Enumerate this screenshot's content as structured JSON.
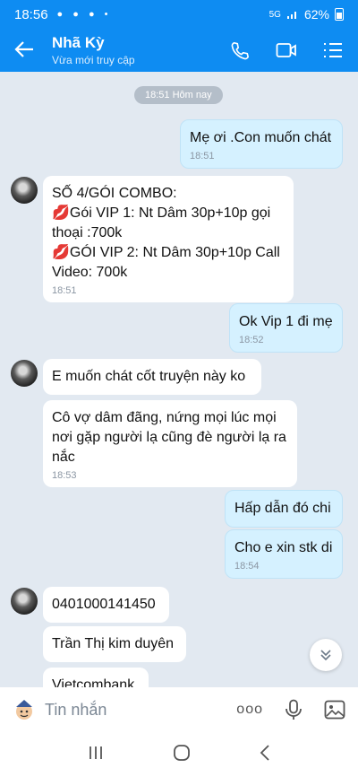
{
  "status": {
    "time": "18:56",
    "notif": "● ● ● •",
    "network": "5G",
    "battery": "62%"
  },
  "header": {
    "name": "Nhã Kỳ",
    "subtitle": "Vừa mới truy cập"
  },
  "chat": {
    "date_pill": "18:51 Hôm nay",
    "messages": [
      {
        "from": "me",
        "text": "Mẹ ơi .Con muốn chát",
        "time": "18:51"
      },
      {
        "from": "them",
        "lines": [
          "SỐ 4/GÓI COMBO:",
          "💋Gói VIP 1: Nt Dâm 30p+10p gọi",
          "thoại :700k",
          "💋GÓI VIP 2: Nt Dâm 30p+10p Call",
          "Video: 700k"
        ],
        "time": "18:51"
      },
      {
        "from": "me",
        "text": "Ok Vip 1 đi mẹ",
        "time": "18:52"
      },
      {
        "from": "them",
        "text": "E muốn chát cốt truyện này ko"
      },
      {
        "from": "them",
        "lines": [
          "Cô vợ dâm đãng, nứng mọi lúc mọi",
          "nơi gặp người lạ cũng đè người lạ ra",
          "nắc"
        ],
        "time": "18:53"
      },
      {
        "from": "me",
        "text": "Hấp dẫn đó chi"
      },
      {
        "from": "me",
        "text": "Cho e xin stk di",
        "time": "18:54"
      },
      {
        "from": "them",
        "text": "0401000141450"
      },
      {
        "from": "them",
        "text": "Trần Thị kim duyên"
      },
      {
        "from": "them",
        "text": "Vietcombank"
      }
    ]
  },
  "input": {
    "placeholder": "Tin nhắn",
    "more": "ooo"
  }
}
